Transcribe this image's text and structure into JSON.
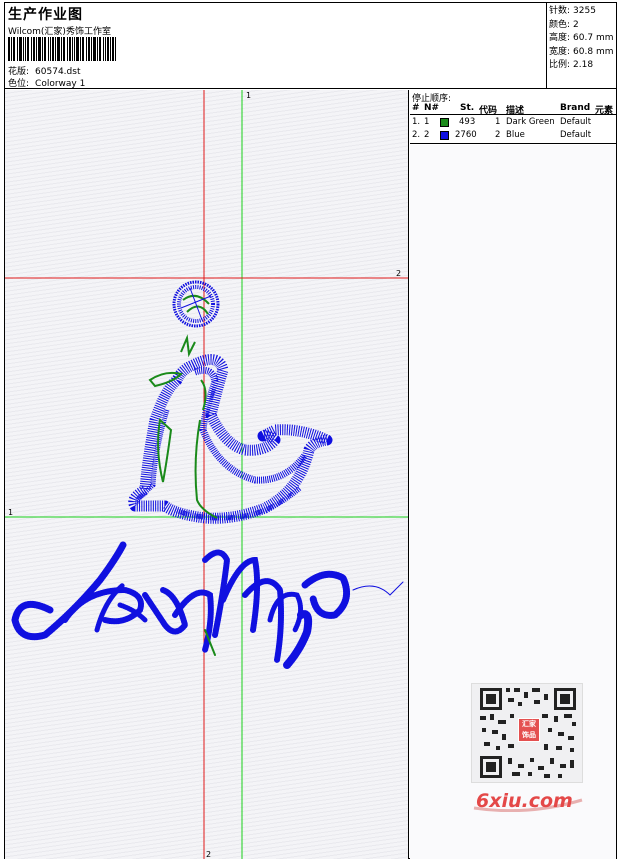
{
  "header": {
    "title": "生产作业图",
    "company": "Wilcom(汇家)秀饰工作室",
    "file_label": "花版:",
    "file_value": "60574.dst",
    "color_label": "色位:",
    "color_value": "Colorway 1"
  },
  "stats": [
    {
      "label": "针数:",
      "value": "3255"
    },
    {
      "label": "颜色:",
      "value": "2"
    },
    {
      "label": "高度:",
      "value": "60.7 mm"
    },
    {
      "label": "宽度:",
      "value": "60.8 mm"
    },
    {
      "label": "比例:",
      "value": "2.18"
    }
  ],
  "stop_panel": {
    "title": "停止顺序:",
    "columns": [
      "#",
      "N#",
      "St.",
      "代码",
      "描述",
      "Brand",
      "元素"
    ],
    "rows": [
      {
        "index": "1.",
        "n": "1",
        "color": "#1a8a1a",
        "stitches": "493",
        "code": "1",
        "description": "Dark Green",
        "brand": "Default"
      },
      {
        "index": "2.",
        "n": "2",
        "color": "#1010e0",
        "stitches": "2760",
        "code": "2",
        "description": "Blue",
        "brand": "Default"
      }
    ]
  },
  "guides": {
    "green_top_label": "1",
    "green_left_label": "1",
    "red_right_label": "2",
    "red_bottom_label": "2"
  },
  "colors": {
    "red_guide": "#e01818",
    "green_guide": "#18d018",
    "thread_blue": "#1010e0",
    "thread_green": "#1a8a1a"
  },
  "qr_logo_text": "汇家 饰品",
  "watermark": "6xiu.com"
}
